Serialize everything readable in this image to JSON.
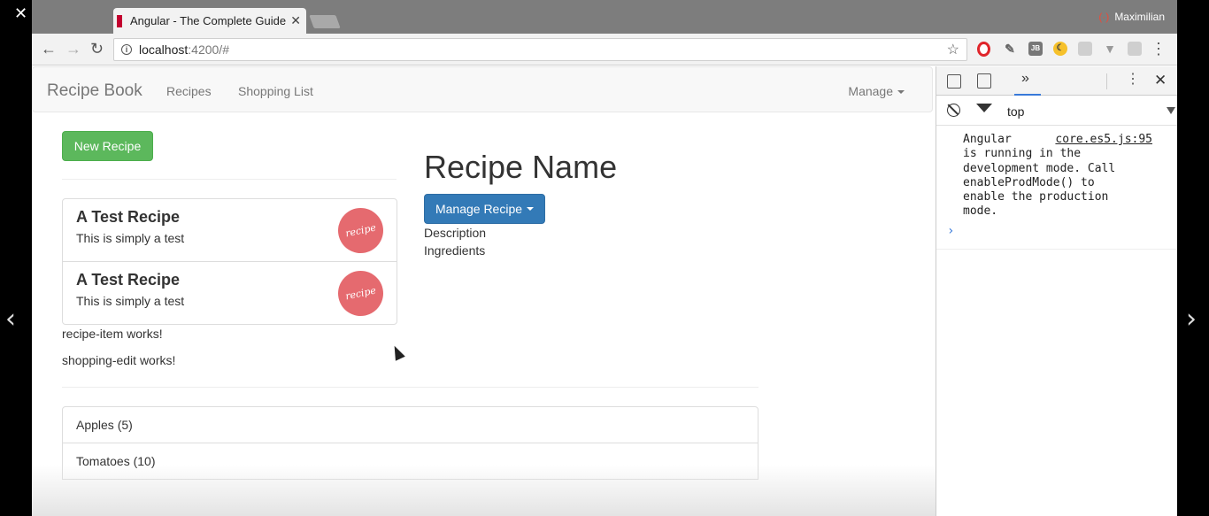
{
  "player": {
    "close_glyph": "✕",
    "prev_glyph": "‹",
    "next_glyph": "›"
  },
  "browser": {
    "tab_title": "Angular - The Complete Guide",
    "tab_close": "✕",
    "profile_name": "Maximilian",
    "url_host": "localhost",
    "url_path": ":4200/#",
    "back_glyph": "←",
    "forward_glyph": "→",
    "reload_glyph": "↻",
    "star_glyph": "☆",
    "menu_glyph": "⋮",
    "ext_jb": "JB"
  },
  "navbar": {
    "brand": "Recipe Book",
    "links": [
      "Recipes",
      "Shopping List"
    ],
    "manage": "Manage"
  },
  "recipes": {
    "new_button": "New Recipe",
    "items": [
      {
        "name": "A Test Recipe",
        "description": "This is simply a test",
        "image_text": "recipe"
      },
      {
        "name": "A Test Recipe",
        "description": "This is simply a test",
        "image_text": "recipe"
      }
    ],
    "recipe_item_works": "recipe-item works!",
    "shopping_edit_works": "shopping-edit works!"
  },
  "detail": {
    "name": "Recipe Name",
    "manage_button": "Manage Recipe",
    "description": "Description",
    "ingredients": "Ingredients"
  },
  "shopping_list": [
    "Apples (5)",
    "Tomatoes (10)"
  ],
  "devtools": {
    "more_tabs": "»",
    "menu": "⋮",
    "close": "✕",
    "context": "top",
    "console_source": "core.es5.js:95",
    "console_message": "Angular\nis running in the\ndevelopment mode. Call\nenableProdMode() to\nenable the production\nmode.",
    "prompt": "›"
  },
  "colors": {
    "success": "#5cb85c",
    "primary": "#337ab7",
    "recipe_image": "#e56a6f",
    "tabstrip": "#7d7d7d"
  },
  "icons": [
    "close-icon",
    "restore-icon",
    "minimize-icon",
    "back-icon",
    "forward-icon",
    "reload-icon",
    "info-icon",
    "star-icon",
    "opera-icon",
    "eyedropper-icon",
    "jetbrains-icon",
    "moon-icon",
    "grid-icon",
    "vue-icon",
    "cast-icon",
    "kebab-menu-icon",
    "inspect-icon",
    "device-icon",
    "clear-console-icon",
    "filter-icon"
  ]
}
